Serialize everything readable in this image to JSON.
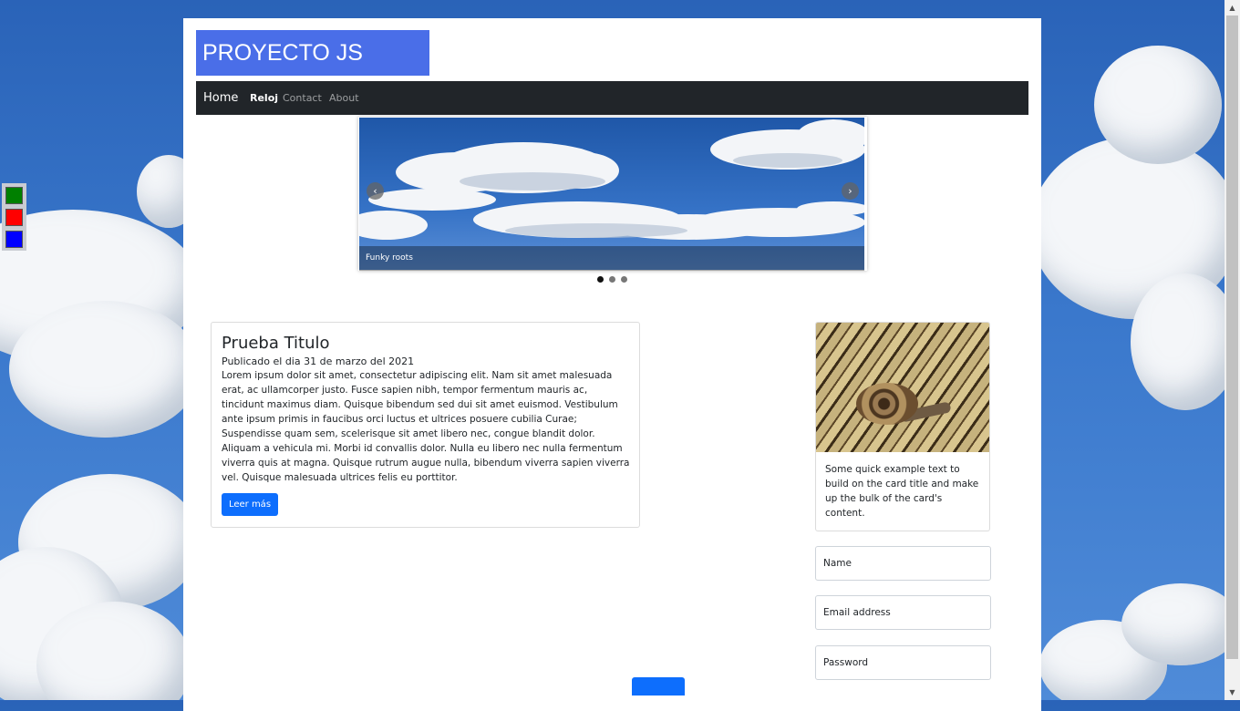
{
  "brand": {
    "title": "PROYECTO JS",
    "color": "#4a6ee8"
  },
  "nav": {
    "home": "Home",
    "links": [
      "Reloj",
      "Contact",
      "About"
    ],
    "active": "Reloj"
  },
  "theme_switcher": {
    "colors": [
      "#008000",
      "#ff0000",
      "#0000ff"
    ]
  },
  "carousel": {
    "caption": "Funky roots",
    "prev_icon": "chevron-left-icon",
    "next_icon": "chevron-right-icon",
    "indicator_count": 3,
    "active_index": 0
  },
  "post": {
    "title": "Prueba Titulo",
    "date": "Publicado el dia 31 de marzo del 2021",
    "body": "Lorem ipsum dolor sit amet, consectetur adipiscing elit. Nam sit amet malesuada erat, ac ullamcorper justo. Fusce sapien nibh, tempor fermentum mauris ac, tincidunt maximus diam. Quisque bibendum sed dui sit amet euismod. Vestibulum ante ipsum primis in faucibus orci luctus et ultrices posuere cubilia Curae; Suspendisse quam sem, scelerisque sit amet libero nec, congue blandit dolor. Aliquam a vehicula mi. Morbi id convallis dolor. Nulla eu libero nec nulla fermentum viverra quis at magna. Quisque rutrum augue nulla, bibendum viverra sapien viverra vel. Quisque malesuada ultrices felis eu porttitor.",
    "button": "Leer más"
  },
  "card": {
    "text": "Some quick example text to build on the card title and make up the bulk of the card's content."
  },
  "form": {
    "name": "Name",
    "email": "Email address",
    "password": "Password"
  },
  "colors": {
    "primary": "#0d6efd",
    "navbar": "#212529"
  }
}
